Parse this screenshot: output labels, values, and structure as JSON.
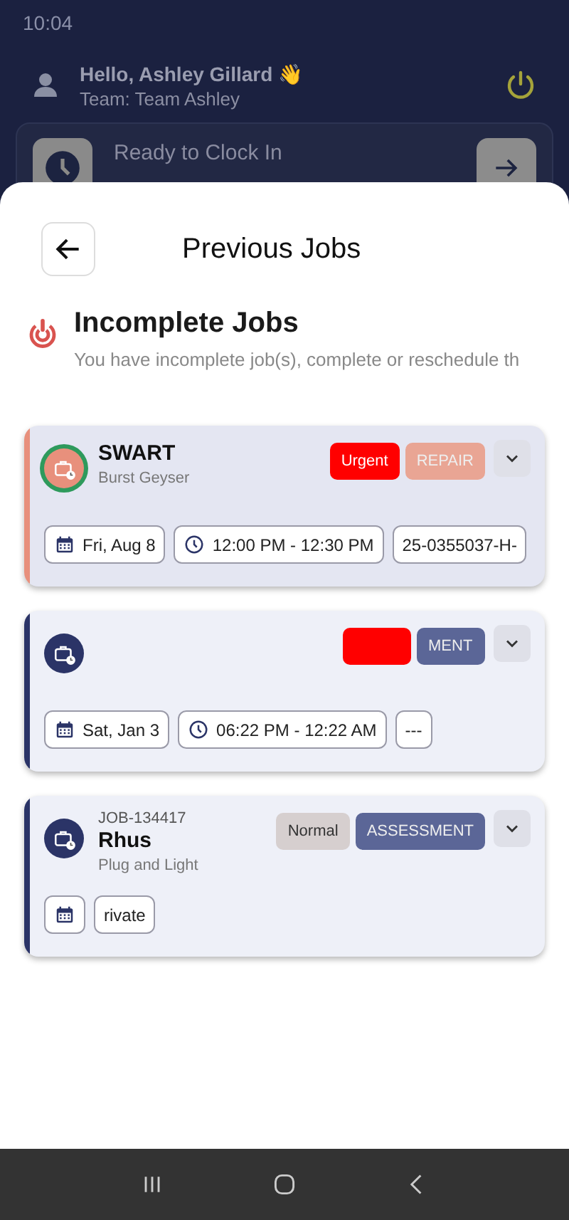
{
  "status_bar": {
    "time": "10:04"
  },
  "header": {
    "greeting": "Hello, Ashley Gillard 👋",
    "team": "Team: Team Ashley",
    "clock_card": {
      "title": "Ready to Clock In"
    }
  },
  "sheet": {
    "title": "Previous Jobs",
    "section_title": "Incomplete Jobs",
    "description": "You have incomplete job(s), complete or reschedule th",
    "jobs": [
      {
        "color": "#e8907c",
        "avatar_ring": true,
        "title": "SWART",
        "subtitle": "Burst Geyser",
        "tags": [
          {
            "label": "Urgent",
            "color": "#ff0000",
            "kind": "solid"
          },
          {
            "label": "REPAIR",
            "color": "#e9a594",
            "kind": "outline"
          }
        ],
        "chips": [
          {
            "kind": "date",
            "label": "Fri, Aug 8"
          },
          {
            "kind": "time",
            "label": "12:00 PM - 12:30 PM"
          },
          {
            "kind": "text",
            "label": "25-0355037-H-"
          }
        ]
      },
      {
        "color": "#2b3467",
        "avatar_ring": false,
        "tags": [
          {
            "color": "#ff0000",
            "kind": "solid"
          },
          {
            "label": "MENT",
            "color": "#5b6697",
            "kind": "outline"
          }
        ],
        "chips": [
          {
            "kind": "date",
            "label": "Sat, Jan 3"
          },
          {
            "kind": "time",
            "label": "06:22 PM - 12:22 AM"
          },
          {
            "kind": "text",
            "label": "---"
          }
        ]
      },
      {
        "color": "#2b3467",
        "avatar_ring": false,
        "job_id": "JOB-134417",
        "title": "Rhus",
        "subtitle": "Plug and Light",
        "tags": [
          {
            "label": "Normal",
            "color": "#d6cfcf",
            "kind": "solid"
          },
          {
            "label": "ASSESSMENT",
            "color": "#5b6697",
            "kind": "outline"
          }
        ],
        "chips": [
          {
            "kind": "date"
          },
          {
            "kind": "text",
            "label": "rivate"
          }
        ]
      }
    ]
  }
}
